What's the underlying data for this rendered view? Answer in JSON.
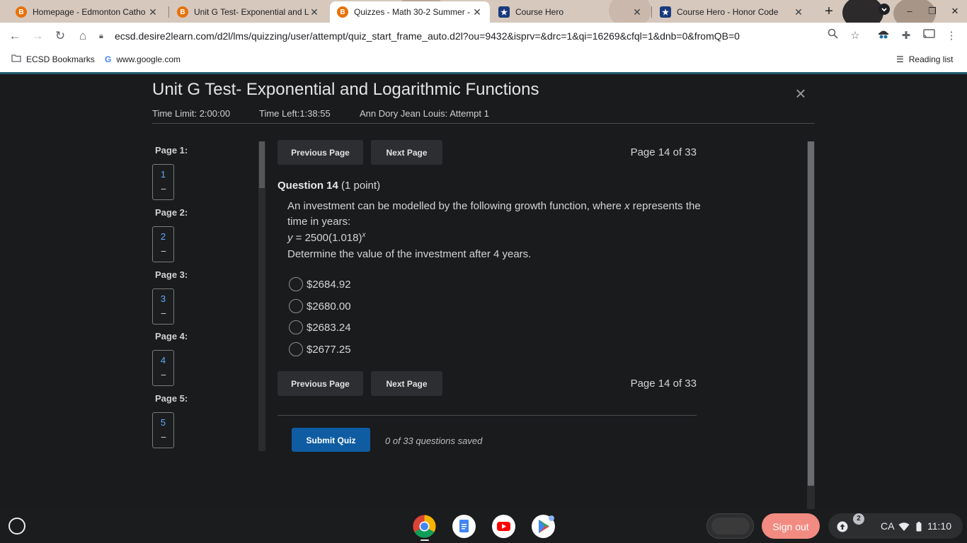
{
  "browser": {
    "tabs": [
      {
        "label": "Homepage - Edmonton Catho",
        "icon": "brightspace-icon"
      },
      {
        "label": "Unit G Test- Exponential and L",
        "icon": "brightspace-icon"
      },
      {
        "label": "Quizzes - Math 30-2 Summer -",
        "icon": "brightspace-icon"
      },
      {
        "label": "Course Hero",
        "icon": "coursehero-icon"
      },
      {
        "label": "Course Hero - Honor Code",
        "icon": "coursehero-icon"
      }
    ],
    "favicon_letter": "B",
    "close_glyph": "✕",
    "new_tab_glyph": "+",
    "url": "ecsd.desire2learn.com/d2l/lms/quizzing/user/attempt/quiz_start_frame_auto.d2l?ou=9432&isprv=&drc=1&qi=16269&cfql=1&dnb=0&fromQB=0",
    "bookmarks": [
      {
        "label": "ECSD Bookmarks",
        "icon": "folder-icon"
      },
      {
        "label": "www.google.com",
        "icon": "google-icon"
      }
    ],
    "reading_list": "Reading list"
  },
  "quiz": {
    "title": "Unit G Test- Exponential and Logarithmic Functions",
    "close_glyph": "×",
    "time_limit": "Time Limit: 2:00:00",
    "time_left": "Time Left:1:38:55",
    "attempt": "Ann Dory Jean Louis: Attempt 1",
    "pages": [
      {
        "label": "Page 1:",
        "num": "1",
        "status": "--"
      },
      {
        "label": "Page 2:",
        "num": "2",
        "status": "--"
      },
      {
        "label": "Page 3:",
        "num": "3",
        "status": "--"
      },
      {
        "label": "Page 4:",
        "num": "4",
        "status": "--"
      },
      {
        "label": "Page 5:",
        "num": "5",
        "status": "--"
      }
    ],
    "prev_label": "Previous Page",
    "next_label": "Next Page",
    "page_indicator": "Page 14 of 33",
    "question_number": "Question 14",
    "question_points": "(1 point)",
    "question_text_1": "An investment can be modelled by the following growth function, where ",
    "question_var": "x",
    "question_text_2": " represents the time in years:",
    "equation_y": "y",
    "equation_body": " = 2500(1.018)",
    "equation_exp": "x",
    "question_prompt": "Determine the value of the investment after 4 years.",
    "options": [
      "$2684.92",
      "$2680.00",
      "$2683.24",
      "$2677.25"
    ],
    "submit_label": "Submit Quiz",
    "saved_status": "0 of 33 questions saved"
  },
  "shelf": {
    "signout_label": "Sign out",
    "notification_count": "2",
    "locale": "CA",
    "clock": "11:10"
  }
}
